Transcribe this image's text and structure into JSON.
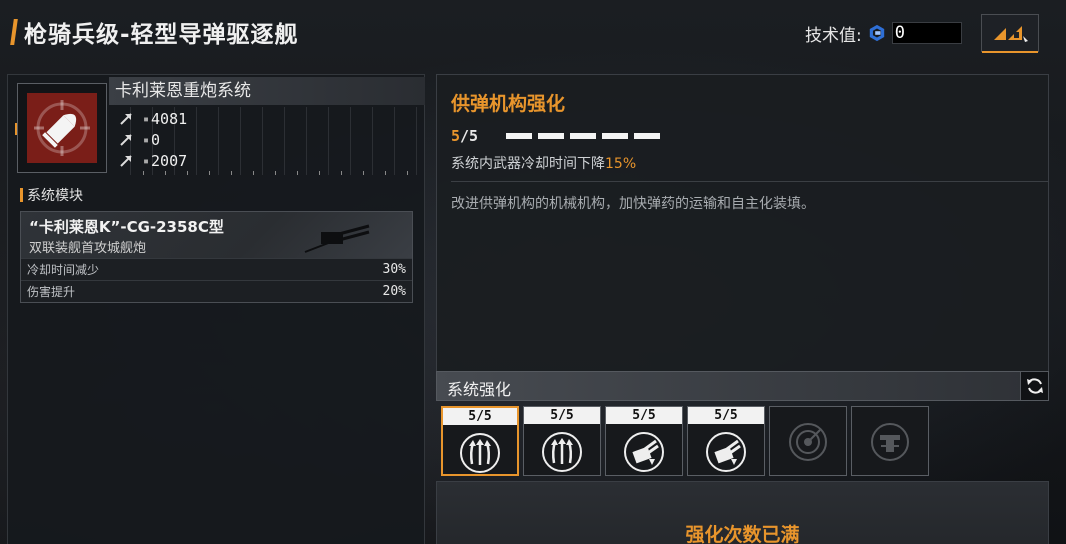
{
  "header": {
    "title": "枪骑兵级-轻型导弹驱逐舰",
    "tech_label": "技术值:",
    "tech_value": "0"
  },
  "system": {
    "name": "卡利莱恩重炮系统",
    "stats": [
      "4081",
      "0",
      "2007"
    ],
    "module_section_label": "系统模块",
    "module": {
      "name": "“卡利莱恩K”-CG-2358C型",
      "subtitle": "双联装舰首攻城舰炮",
      "rows": [
        {
          "label": "冷却时间减少",
          "value": "30%"
        },
        {
          "label": "伤害提升",
          "value": "20%"
        }
      ]
    }
  },
  "upgrade": {
    "title": "供弹机构强化",
    "level_current": "5",
    "level_max": "/5",
    "pips": 5,
    "effect_prefix": "系统内武器冷却时间下降",
    "effect_value": "15%",
    "description": "改进供弹机构的机械机构，加快弹药的运输和自主化装填。"
  },
  "enhancement": {
    "label": "系统强化",
    "slots": [
      {
        "level": "5/5",
        "icon": "arrows-up-icon",
        "selected": true
      },
      {
        "level": "5/5",
        "icon": "arrows-up-icon",
        "selected": false
      },
      {
        "level": "5/5",
        "icon": "turret-icon",
        "selected": false
      },
      {
        "level": "5/5",
        "icon": "turret-icon",
        "selected": false
      },
      {
        "level": "",
        "icon": "radar-icon",
        "locked": true
      },
      {
        "level": "",
        "icon": "cannon-icon",
        "locked": true
      }
    ],
    "maxed_text": "强化次数已满"
  },
  "colors": {
    "accent": "#e8952c",
    "weapon_bg": "#7a1e18"
  }
}
